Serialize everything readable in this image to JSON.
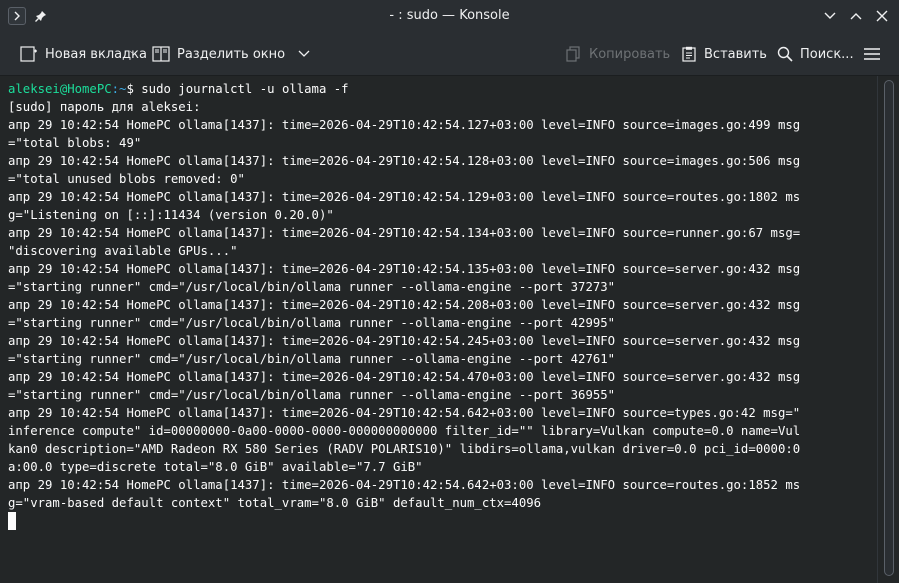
{
  "window": {
    "title": "- : sudo — Konsole"
  },
  "toolbar": {
    "new_tab": "Новая вкладка",
    "split_view": "Разделить окно",
    "copy": "Копировать",
    "paste": "Вставить",
    "find": "Поиск..."
  },
  "terminal": {
    "prompt_user": "aleksei@HomePC",
    "prompt_path": ":~",
    "prompt_command": "$ sudo journalctl -u ollama -f",
    "lines": [
      "[sudo] пароль для aleksei:",
      "апр 29 10:42:54 HomePC ollama[1437]: time=2026-04-29T10:42:54.127+03:00 level=INFO source=images.go:499 msg",
      "=\"total blobs: 49\"",
      "апр 29 10:42:54 HomePC ollama[1437]: time=2026-04-29T10:42:54.128+03:00 level=INFO source=images.go:506 msg",
      "=\"total unused blobs removed: 0\"",
      "апр 29 10:42:54 HomePC ollama[1437]: time=2026-04-29T10:42:54.129+03:00 level=INFO source=routes.go:1802 ms",
      "g=\"Listening on [::]:11434 (version 0.20.0)\"",
      "апр 29 10:42:54 HomePC ollama[1437]: time=2026-04-29T10:42:54.134+03:00 level=INFO source=runner.go:67 msg=",
      "\"discovering available GPUs...\"",
      "апр 29 10:42:54 HomePC ollama[1437]: time=2026-04-29T10:42:54.135+03:00 level=INFO source=server.go:432 msg",
      "=\"starting runner\" cmd=\"/usr/local/bin/ollama runner --ollama-engine --port 37273\"",
      "апр 29 10:42:54 HomePC ollama[1437]: time=2026-04-29T10:42:54.208+03:00 level=INFO source=server.go:432 msg",
      "=\"starting runner\" cmd=\"/usr/local/bin/ollama runner --ollama-engine --port 42995\"",
      "апр 29 10:42:54 HomePC ollama[1437]: time=2026-04-29T10:42:54.245+03:00 level=INFO source=server.go:432 msg",
      "=\"starting runner\" cmd=\"/usr/local/bin/ollama runner --ollama-engine --port 42761\"",
      "апр 29 10:42:54 HomePC ollama[1437]: time=2026-04-29T10:42:54.470+03:00 level=INFO source=server.go:432 msg",
      "=\"starting runner\" cmd=\"/usr/local/bin/ollama runner --ollama-engine --port 36955\"",
      "апр 29 10:42:54 HomePC ollama[1437]: time=2026-04-29T10:42:54.642+03:00 level=INFO source=types.go:42 msg=\"",
      "inference compute\" id=00000000-0a00-0000-0000-000000000000 filter_id=\"\" library=Vulkan compute=0.0 name=Vul",
      "kan0 description=\"AMD Radeon RX 580 Series (RADV POLARIS10)\" libdirs=ollama,vulkan driver=0.0 pci_id=0000:0",
      "a:00.0 type=discrete total=\"8.0 GiB\" available=\"7.7 GiB\"",
      "апр 29 10:42:54 HomePC ollama[1437]: time=2026-04-29T10:42:54.642+03:00 level=INFO source=routes.go:1852 ms",
      "g=\"vram-based default context\" total_vram=\"8.0 GiB\" default_num_ctx=4096"
    ]
  },
  "colors": {
    "prompt_user": "#1cdc9a",
    "prompt_path": "#3daee9",
    "background": "#232627"
  }
}
